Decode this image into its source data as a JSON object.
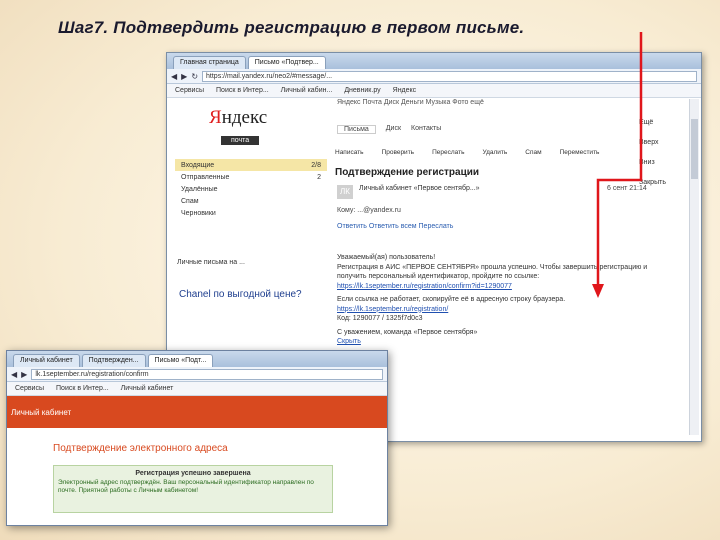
{
  "slide": {
    "title": "Шаг7. Подтвердить регистрацию в первом письме."
  },
  "main_window": {
    "tabs": [
      "Главная страница",
      "Письмо «Подтвер..."
    ],
    "url": "https://mail.yandex.ru/neo2/#message/...",
    "bookmarks": [
      "Сервисы",
      "Поиск в Интер...",
      "Личный кабин...",
      "Дневник.ру",
      "Яндекс"
    ],
    "yandex_menu": "Яндекс  Почта  Диск  Деньги  Музыка  Фото  ещё",
    "logo_word": "Яндекс",
    "logo_sub": "почта",
    "mail_tabs": [
      "Письма",
      "Диск",
      "Контакты"
    ],
    "toolbar": [
      "Написать",
      "Проверить",
      "Переслать",
      "Удалить",
      "Спам",
      "Переместить"
    ],
    "folders": [
      {
        "name": "Входящие",
        "count": "2/8"
      },
      {
        "name": "Отправленные",
        "count": "2"
      },
      {
        "name": "Удалённые",
        "count": ""
      },
      {
        "name": "Спам",
        "count": ""
      },
      {
        "name": "Черновики",
        "count": ""
      }
    ],
    "ad_line": "Личные письма на ...",
    "chanel_ad": "Chanel по выгодной цене?",
    "subject": "Подтверждение регистрации",
    "lk": "ЛК",
    "sender": "Личный кабинет «Первое сентябр...»",
    "date": "6 сент 21:14",
    "to_line": "Кому: ...@yandex.ru",
    "actions": "Ответить  Ответить всем  Переслать",
    "body_greeting": "Уважаемый(ая) пользователь!",
    "body_text": "Регистрация в АИС «ПЕРВОЕ СЕНТЯБРЯ» прошла успешно. Чтобы завершить регистрацию и получить персональный идентификатор, пройдите по ссылке:",
    "body_link1": "https://lk.1september.ru/registration/confirm?id=1290077",
    "body_text2": "Если ссылка не работает, скопируйте её в адресную строку браузера.",
    "body_link2": "https://lk.1september.ru/registration/",
    "body_code": "Код: 1290077 / 1325f7d0c3",
    "body_footer": "С уважением, команда «Первое сентября»",
    "body_more": "Скрыть",
    "right_items": [
      "Ещё",
      "Вверх",
      "Вниз",
      "Закрыть"
    ]
  },
  "front_window": {
    "tabs": [
      "Личный кабинет",
      "Подтвержден...",
      "Письмо «Подт..."
    ],
    "url": "lk.1september.ru/registration/confirm",
    "bookmarks": [
      "Сервисы",
      "Поиск в Интер...",
      "Личный кабинет"
    ],
    "orange_title": "Личный кабинет",
    "heading": "Подтверждение электронного адреса",
    "box_title": "Регистрация успешно завершена",
    "box_text": "Электронный адрес подтверждён. Ваш персональный идентификатор направлен по почте. Приятной работы с Личным кабинетом!"
  }
}
